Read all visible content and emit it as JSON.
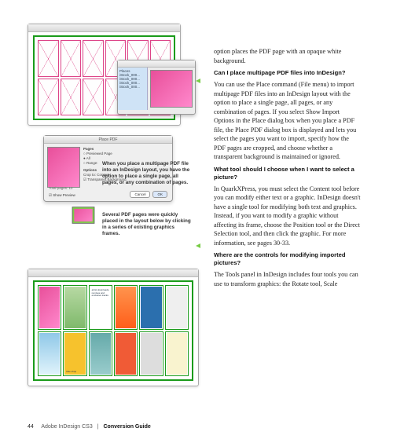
{
  "captions": {
    "place_dialog": "When you place a multipage PDF file into an InDesign layout, you have the option to place a single page, all pages, or any combination of pages.",
    "placed_series": "Several PDF pages were quickly placed in the layout below by clicking in a series of existing graphics frames."
  },
  "body": {
    "intro_tail": "option places the PDF page with an opaque white background.",
    "q1": "Can I place multipage PDF files into InDesign?",
    "a1": "You can use the Place command (File menu) to import multipage PDF files into an InDesign layout with the option to place a single page, all pages, or any combination of pages. If you select Show Import Options in the Place dialog box when you place a PDF file, the Place PDF dialog box is displayed and lets you select the pages you want to import, specify how the PDF pages are cropped, and choose whether a transparent background is maintained or ignored.",
    "q2": "What tool should I choose when I want to select a picture?",
    "a2": "In QuarkXPress, you must select the Content tool before you can modify either text or a graphic. InDesign doesn't have a single tool for modifying both text and graphics. Instead, if you want to modify a graphic without affecting its frame, choose the Position tool or the Direct Selection tool, and then click the graphic. For more information, see pages 30-33.",
    "q3": "Where are the controls for modifying imported pictures?",
    "a3": "The Tools panel in InDesign includes four tools you can use to transform graphics: the Rotate tool, Scale"
  },
  "dialog": {
    "title": "Place PDF",
    "pages_label": "Pages",
    "opt_previewed": "Previewed Page",
    "opt_all": "All",
    "opt_range": "Range:",
    "options_label": "Options",
    "crop_label": "Crop to:",
    "crop_value": "Content",
    "transparent": "Transparent Background",
    "show_preview": "Show Preview",
    "cancel": "Cancel",
    "ok": "OK",
    "total_pages": "Total pages: 12"
  },
  "panel": {
    "place_list": "Places\niStock_000...\niStock_000...\niStock_000...\niStock_000..."
  },
  "layout_thumbs": {
    "t3": "artist downloads, remixes and exclusive tracks",
    "t8": "bike shop"
  },
  "footer": {
    "page": "44",
    "product": "Adobe InDesign CS3",
    "sep": "|",
    "doc": "Conversion Guide"
  }
}
